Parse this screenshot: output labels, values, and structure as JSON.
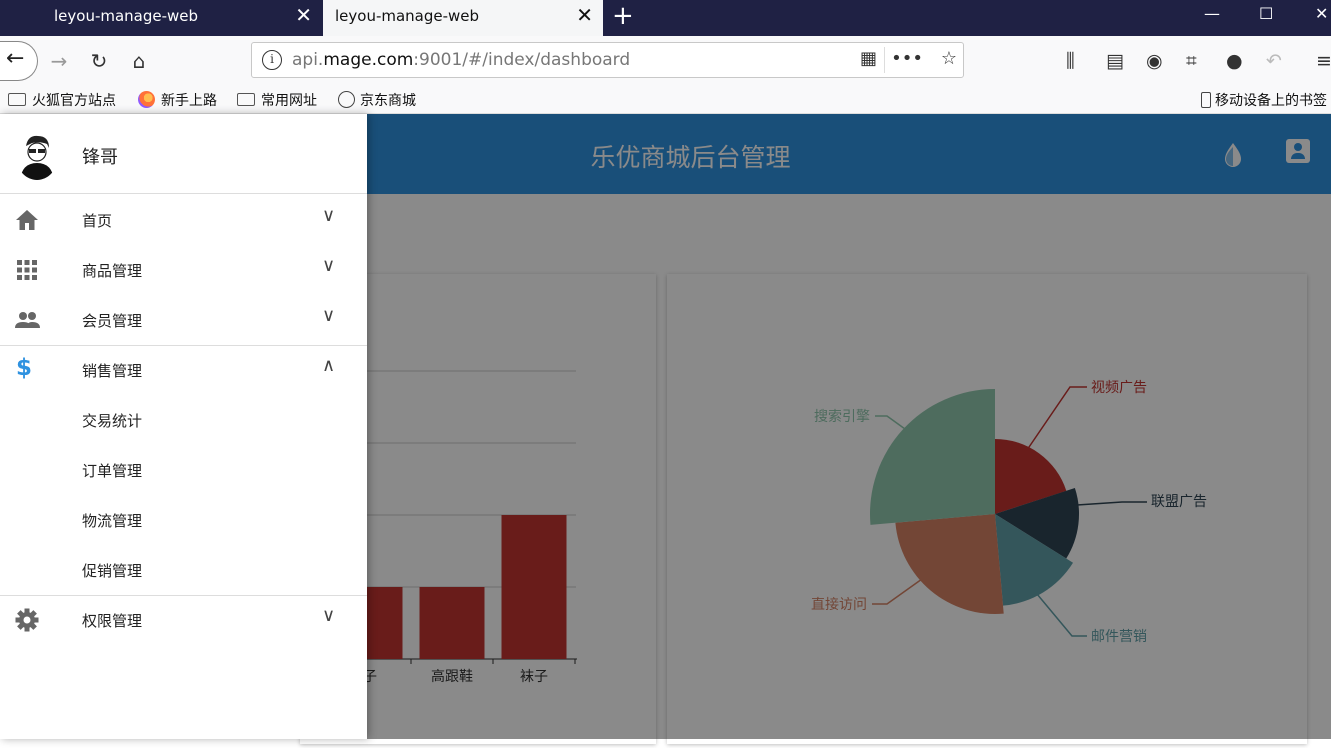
{
  "browser": {
    "tabs": [
      {
        "label": "leyou-manage-web",
        "active": false
      },
      {
        "label": "leyou-manage-web",
        "active": true
      }
    ],
    "close_glyph": "✕",
    "new_tab_glyph": "+",
    "url_prefix": "api.",
    "url_domain": "mage.com",
    "url_rest": ":9001/#/index/dashboard",
    "bookmarks": [
      "火狐官方站点",
      "新手上路",
      "常用网址",
      "京东商城"
    ],
    "mobile_bookmarks": "移动设备上的书签"
  },
  "app": {
    "title": "乐优商城后台管理",
    "accent_color": "#2f92e0",
    "user": {
      "name": "锋哥"
    },
    "menu": [
      {
        "label": "首页",
        "icon": "home-icon",
        "expanded": false
      },
      {
        "label": "商品管理",
        "icon": "apps-grid-icon",
        "expanded": false
      },
      {
        "label": "会员管理",
        "icon": "people-icon",
        "expanded": false
      },
      {
        "label": "销售管理",
        "icon": "dollar-icon",
        "expanded": true,
        "children": [
          "交易统计",
          "订单管理",
          "物流管理",
          "促销管理"
        ]
      },
      {
        "label": "权限管理",
        "icon": "gear-icon",
        "expanded": false
      }
    ]
  },
  "chart_data": [
    {
      "type": "bar",
      "categories": [
        "袜子",
        "高跟鞋",
        "袜子"
      ],
      "visible_tick_labels": [
        "子",
        "高跟鞋",
        "袜子"
      ],
      "values": [
        10,
        10,
        20
      ],
      "color": "#c23531"
    },
    {
      "type": "pie",
      "rose": true,
      "series": [
        {
          "name": "视频广告",
          "color": "#c23531"
        },
        {
          "name": "联盟广告",
          "color": "#2f4554"
        },
        {
          "name": "邮件营销",
          "color": "#61a0a8"
        },
        {
          "name": "直接访问",
          "color": "#d48265"
        },
        {
          "name": "搜索引擎",
          "color": "#91c7ae"
        }
      ]
    }
  ]
}
